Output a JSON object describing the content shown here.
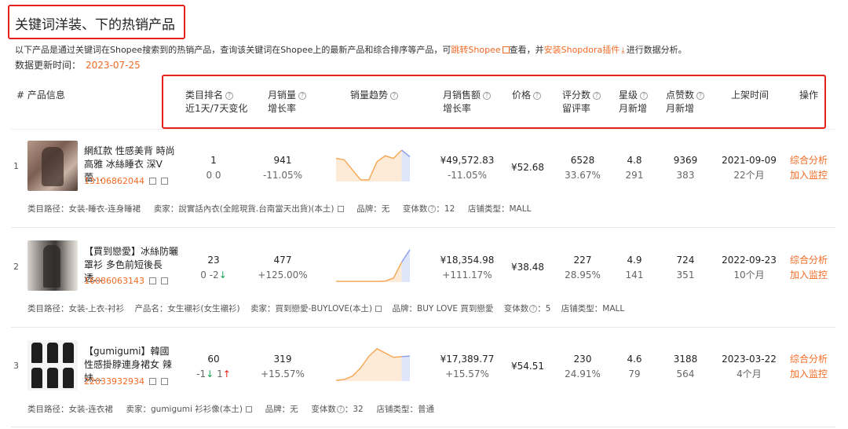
{
  "page": {
    "title": "关键词洋装、下的热销产品",
    "intro_pre": "以下产品是通过关键词在Shopee搜索到的热销产品，查询该关键词在Shopee上的最新产品和综合排序等产品，可",
    "intro_link1": "跳转Shopee",
    "intro_mid": "查看，并",
    "intro_link2": "安装Shopdora插件",
    "intro_post": "进行数据分析。",
    "update_label": "数据更新时间：",
    "update_date": "2023-07-25"
  },
  "columns": {
    "product": "# 产品信息",
    "rank": "类目排名",
    "rank_sub": "近1天/7天变化",
    "sales": "月销量",
    "sales_sub": "增长率",
    "trend": "销量趋势",
    "revenue": "月销售额",
    "revenue_sub": "增长率",
    "price": "价格",
    "reviews": "评分数",
    "reviews_sub": "留评率",
    "rating": "星级",
    "rating_sub": "月新增",
    "likes": "点赞数",
    "likes_sub": "月新增",
    "listed": "上架时间",
    "action": "操作",
    "help": "?"
  },
  "rows": [
    {
      "index": "1",
      "name": "網紅款 性感美背 時尚高雅 冰絲睡衣 深V蕾...",
      "id": "13106862044",
      "rank": "1",
      "rank_change_a": "0",
      "rank_change_b": "0",
      "sales": "941",
      "sales_growth": "-11.05%",
      "revenue": "¥49,572.83",
      "revenue_growth": "-11.05%",
      "price": "¥52.68",
      "reviews": "6528",
      "review_rate": "33.67%",
      "rating": "4.8",
      "rating_new": "291",
      "likes": "9369",
      "likes_new": "383",
      "listed": "2021-09-09",
      "listed_age": "22个月",
      "action1": "综合分析",
      "action2": "加入监控",
      "meta": {
        "path": "类目路径：女装-睡衣-连身睡裙",
        "seller": "卖家：說實話內衣(全館現貨.台南當天出貨)(本土)",
        "brand": "品牌：无",
        "variants": "变体数",
        "variants_val": "：12",
        "shop": "店铺类型：MALL"
      },
      "trend": [
        0.7,
        0.66,
        0.35,
        0.05,
        0.05,
        0.6,
        0.78,
        0.7,
        0.95,
        0.75
      ]
    },
    {
      "index": "2",
      "name": "【買到戀愛】冰絲防曬罩衫 多色前短後長透...",
      "id": "16086063143",
      "rank": "23",
      "rank_change_a": "0",
      "rank_change_b": "-2",
      "sales": "477",
      "sales_growth": "+125.00%",
      "revenue": "¥18,354.98",
      "revenue_growth": "+111.17%",
      "price": "¥38.48",
      "reviews": "227",
      "review_rate": "28.95%",
      "rating": "4.9",
      "rating_new": "141",
      "likes": "724",
      "likes_new": "351",
      "listed": "2022-09-23",
      "listed_age": "10个月",
      "action1": "综合分析",
      "action2": "加入监控",
      "meta": {
        "path": "类目路径：女装-上衣-衬衫",
        "product_name": "产品名：女生襯衫(女生襯衫)",
        "seller": "卖家：買到戀愛-BUYLOVE(本土)",
        "brand": "品牌：BUY LOVE 買到戀愛",
        "variants": "变体数",
        "variants_val": "：5",
        "shop": "店铺类型：MALL"
      },
      "trend": [
        0.02,
        0.02,
        0.02,
        0.02,
        0.02,
        0.02,
        0.03,
        0.12,
        0.6,
        0.98
      ]
    },
    {
      "index": "3",
      "name": "【gumigumi】韓國性感掛脖連身裙女 辣妹...",
      "id": "22033932934",
      "rank": "60",
      "rank_change_a": "-1",
      "rank_change_b": "1",
      "sales": "319",
      "sales_growth": "+15.57%",
      "revenue": "¥17,389.77",
      "revenue_growth": "+15.57%",
      "price": "¥54.51",
      "reviews": "230",
      "review_rate": "24.91%",
      "rating": "4.6",
      "rating_new": "79",
      "likes": "3188",
      "likes_new": "564",
      "listed": "2023-03-22",
      "listed_age": "4个月",
      "action1": "综合分析",
      "action2": "加入监控",
      "meta": {
        "path": "类目路径：女装-连衣裙",
        "seller": "卖家：gumigumi 衫衫像(本土)",
        "brand": "品牌：无",
        "variants": "变体数",
        "variants_val": "：32",
        "shop": "店铺类型：普通"
      },
      "trend": [
        0.02,
        0.05,
        0.15,
        0.4,
        0.75,
        0.98,
        0.85,
        0.72,
        0.74,
        0.76
      ]
    }
  ],
  "colors": {
    "accent": "#f26b25",
    "highlight": "#e8201c",
    "trend_line": "#f5a95a",
    "trend_recent": "#8fa2e8"
  }
}
